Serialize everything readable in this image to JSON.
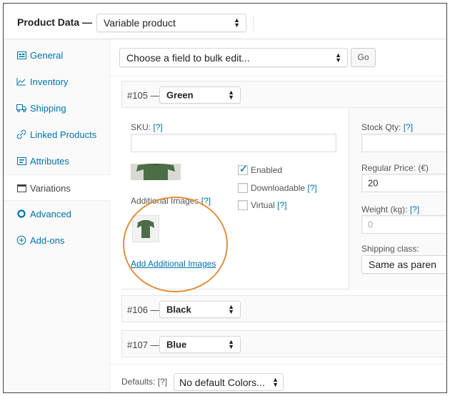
{
  "header": {
    "title": "Product Data —",
    "product_type": "Variable product"
  },
  "sidebar": {
    "tabs": [
      {
        "label": "General",
        "icon": "grid-icon"
      },
      {
        "label": "Inventory",
        "icon": "chart-icon"
      },
      {
        "label": "Shipping",
        "icon": "truck-icon"
      },
      {
        "label": "Linked Products",
        "icon": "link-icon"
      },
      {
        "label": "Attributes",
        "icon": "list-icon"
      },
      {
        "label": "Variations",
        "icon": "window-icon",
        "active": true
      },
      {
        "label": "Advanced",
        "icon": "gear-icon"
      },
      {
        "label": "Add-ons",
        "icon": "plus-circle-icon"
      }
    ]
  },
  "toolbar": {
    "bulk_edit": "Choose a field to bulk edit...",
    "go_label": "Go"
  },
  "variations": [
    {
      "number": "#105 —",
      "value": "Green",
      "expanded": true,
      "sku_label": "SKU:",
      "help": "[?]",
      "sku_value": "",
      "checkboxes": [
        {
          "label": "Enabled",
          "checked": true,
          "help": ""
        },
        {
          "label": "Downloadable",
          "checked": false,
          "help": "[?]"
        },
        {
          "label": "Virtual",
          "checked": false,
          "help": "[?]"
        }
      ],
      "additional_images_label": "Additional Images",
      "add_images_link": "Add Additional Images",
      "stock_qty_label": "Stock Qty:",
      "regular_price_label": "Regular Price: (€)",
      "regular_price_value": "20",
      "weight_label": "Weight (kg):",
      "weight_placeholder": "0",
      "shipping_class_label": "Shipping class:",
      "shipping_class_value": "Same as paren"
    },
    {
      "number": "#106 —",
      "value": "Black"
    },
    {
      "number": "#107 —",
      "value": "Blue"
    }
  ],
  "defaults": {
    "label": "Defaults:",
    "help": "[?]",
    "value": "No default Colors..."
  },
  "colors": {
    "link": "#0073aa",
    "highlight_circle": "#e0913f",
    "shirt_green": "#4b6e47"
  }
}
